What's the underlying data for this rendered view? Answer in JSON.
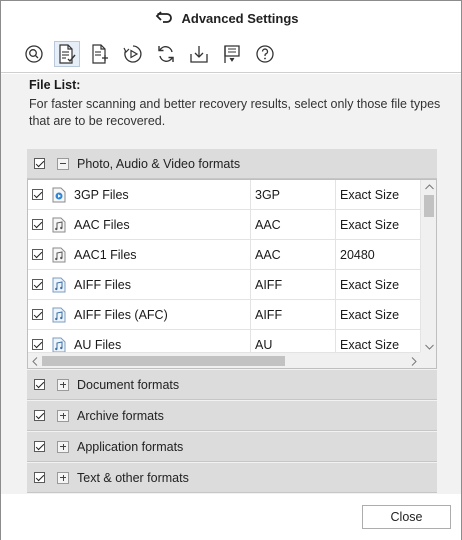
{
  "window": {
    "title": "Advanced Settings"
  },
  "toolbar": {
    "buttons": [
      {
        "icon": "search-scan-icon",
        "active": false
      },
      {
        "icon": "file-list-icon",
        "active": true
      },
      {
        "icon": "add-file-icon",
        "active": false
      },
      {
        "icon": "preview-play-icon",
        "active": false
      },
      {
        "icon": "refresh-icon",
        "active": false
      },
      {
        "icon": "download-icon",
        "active": false
      },
      {
        "icon": "flag-icon",
        "active": false
      },
      {
        "icon": "help-icon",
        "active": false
      }
    ]
  },
  "file_list": {
    "label": "File List:",
    "description": "For faster scanning and better recovery results, select only those file types that are to be recovered."
  },
  "groups": [
    {
      "label": "Photo, Audio & Video formats",
      "checked": true,
      "expanded": true
    },
    {
      "label": "Document formats",
      "checked": true,
      "expanded": false
    },
    {
      "label": "Archive formats",
      "checked": true,
      "expanded": false
    },
    {
      "label": "Application formats",
      "checked": true,
      "expanded": false
    },
    {
      "label": "Text & other formats",
      "checked": true,
      "expanded": false
    }
  ],
  "rows": [
    {
      "name": "3GP Files",
      "ext": "3GP",
      "size": "Exact Size",
      "checked": true,
      "icon": "video-file-icon"
    },
    {
      "name": "AAC Files",
      "ext": "AAC",
      "size": "Exact Size",
      "checked": true,
      "icon": "audio-file-icon"
    },
    {
      "name": "AAC1 Files",
      "ext": "AAC",
      "size": "20480",
      "checked": true,
      "icon": "audio-file-icon"
    },
    {
      "name": "AIFF Files",
      "ext": "AIFF",
      "size": "Exact Size",
      "checked": true,
      "icon": "audio-file-icon"
    },
    {
      "name": "AIFF Files (AFC)",
      "ext": "AIFF",
      "size": "Exact Size",
      "checked": true,
      "icon": "audio-file-icon"
    },
    {
      "name": "AU Files",
      "ext": "AU",
      "size": "Exact Size",
      "checked": true,
      "icon": "audio-file-icon"
    }
  ],
  "footer": {
    "close_label": "Close"
  },
  "colors": {
    "group_bg": "#dcdcdc",
    "panel_bg": "#f2f2f2",
    "active_tool_bg": "#e6eef7"
  }
}
